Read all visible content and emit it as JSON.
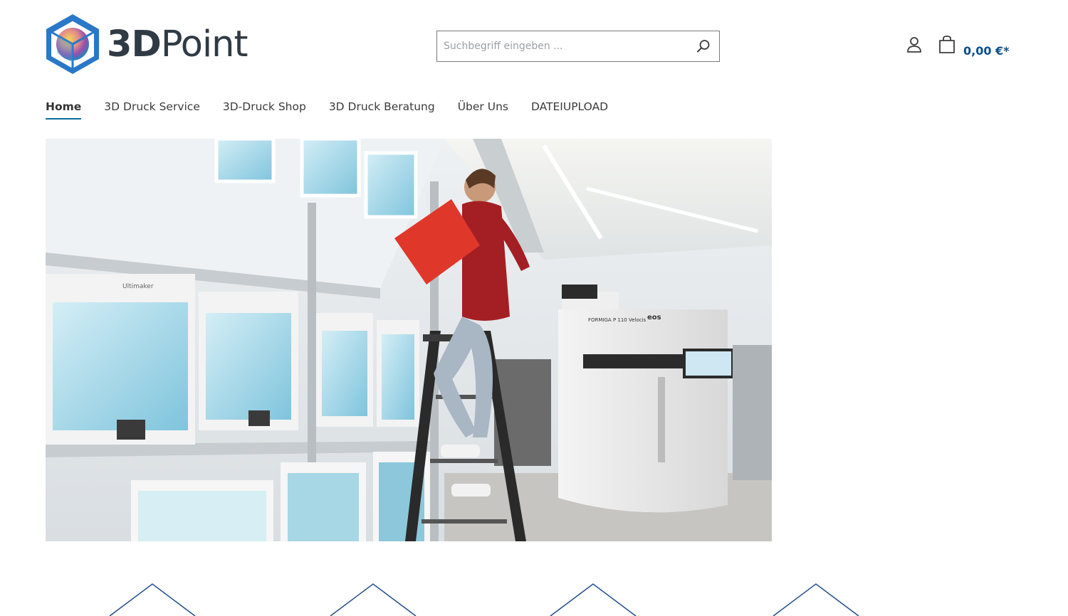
{
  "logo": {
    "text_bold": "3D",
    "text_light": "Point"
  },
  "search": {
    "placeholder": "Suchbegriff eingeben ..."
  },
  "icons": {
    "logo": "cube-logo-icon",
    "search": "search-icon",
    "account": "user-icon",
    "cart": "shopping-bag-icon"
  },
  "cart": {
    "total": "0,00 €*"
  },
  "nav": {
    "items": [
      {
        "label": "Home"
      },
      {
        "label": "3D Druck Service"
      },
      {
        "label": "3D-Druck Shop"
      },
      {
        "label": "3D Druck Beratung"
      },
      {
        "label": "Über Uns"
      },
      {
        "label": "DATEIUPLOAD"
      }
    ],
    "active_index": 0
  },
  "hero": {
    "machine_brand": "eos",
    "machine_label": "FORMIGA P 110 Velocis",
    "printer_brand": "Ultimaker"
  },
  "colors": {
    "accent": "#0a4f8a",
    "nav_underline": "#0a6b9a",
    "text": "#2f3a44"
  }
}
